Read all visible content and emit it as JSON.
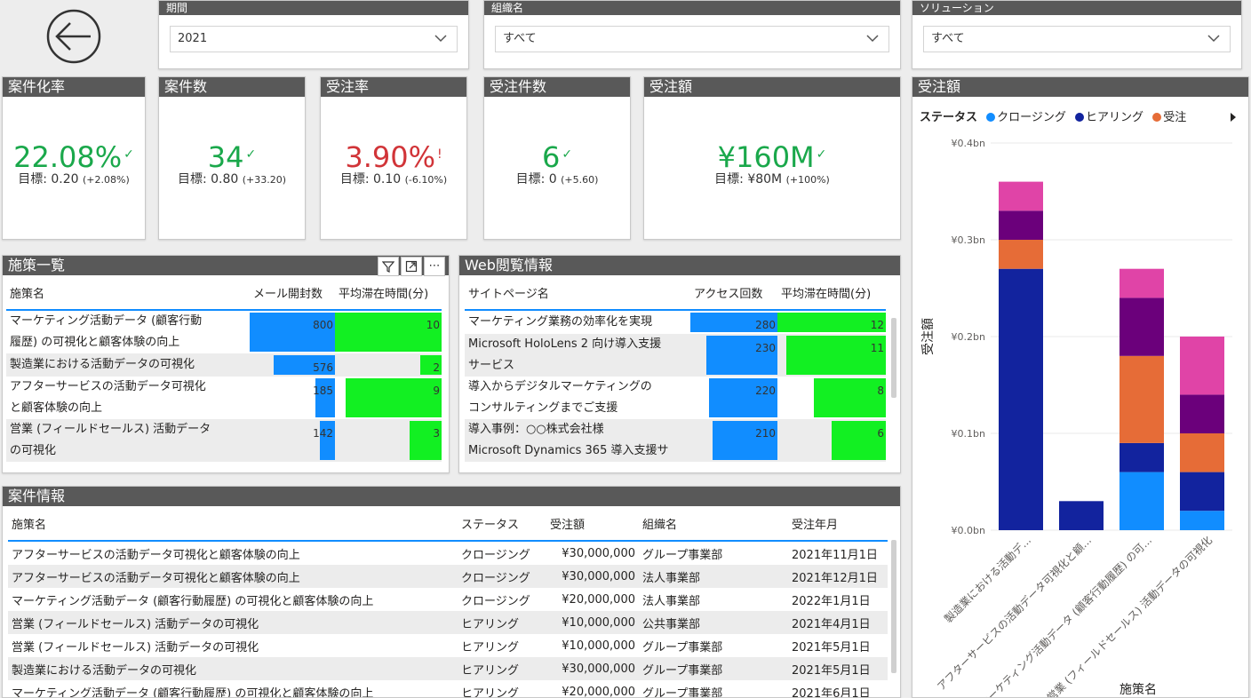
{
  "slicers": {
    "period": {
      "label": "期間",
      "value": "2021"
    },
    "org": {
      "label": "組織名",
      "value": "すべて"
    },
    "solution": {
      "label": "ソリューション",
      "value": "すべて"
    }
  },
  "kpis": [
    {
      "title": "案件化率",
      "value": "22.08%",
      "mark": "✓",
      "status": "good",
      "target_label": "目標: 0.20",
      "target_diff": "(+2.08%)"
    },
    {
      "title": "案件数",
      "value": "34",
      "mark": "✓",
      "status": "good",
      "target_label": "目標: 0.80",
      "target_diff": "(+33.20)"
    },
    {
      "title": "受注率",
      "value": "3.90%",
      "mark": "!",
      "status": "bad",
      "target_label": "目標: 0.10",
      "target_diff": "(-6.10%)"
    },
    {
      "title": "受注件数",
      "value": "6",
      "mark": "✓",
      "status": "good",
      "target_label": "目標: 0",
      "target_diff": "(+5.60)"
    },
    {
      "title": "受注額",
      "value": "¥160M",
      "mark": "✓",
      "status": "good",
      "target_label": "目標: ¥80M",
      "target_diff": "(+100%)"
    }
  ],
  "measures": {
    "title": "施策一覧",
    "columns": [
      "施策名",
      "メール開封数",
      "平均滞在時間(分)"
    ],
    "rows": [
      {
        "name": [
          "マーケティング活動データ (顧客行動",
          "履歴) の可視化と顧客体験の向上"
        ],
        "opens": 800,
        "stay": 10
      },
      {
        "name": [
          "製造業における活動データの可視化"
        ],
        "opens": 576,
        "stay": 2
      },
      {
        "name": [
          "アフターサービスの活動データ可視化",
          "と顧客体験の向上"
        ],
        "opens": 185,
        "stay": 9
      },
      {
        "name": [
          "営業 (フィールドセールス) 活動データ",
          "の可視化"
        ],
        "opens": 142,
        "stay": 3
      }
    ],
    "opens_max": 800,
    "stay_max": 10
  },
  "web": {
    "title": "Web閲覧情報",
    "columns": [
      "サイトページ名",
      "アクセス回数",
      "平均滞在時間(分)"
    ],
    "rows": [
      {
        "name": [
          "マーケティング業務の効率化を実現"
        ],
        "access": 280,
        "stay": 12
      },
      {
        "name": [
          "Microsoft HoloLens 2 向け導入支援",
          "サービス"
        ],
        "access": 230,
        "stay": 11
      },
      {
        "name": [
          "導入からデジタルマーケティングの",
          "コンサルティングまでご支援"
        ],
        "access": 220,
        "stay": 8
      },
      {
        "name": [
          "導入事例：○○株式会社様",
          "Microsoft Dynamics 365 導入支援サ"
        ],
        "access": 210,
        "stay": 6
      }
    ],
    "access_max": 280,
    "stay_max": 12
  },
  "deals": {
    "title": "案件情報",
    "columns": [
      "施策名",
      "ステータス",
      "受注額",
      "組織名",
      "受注年月"
    ],
    "rows": [
      [
        "アフターサービスの活動データ可視化と顧客体験の向上",
        "クロージング",
        "¥30,000,000",
        "グループ事業部",
        "2021年11月1日"
      ],
      [
        "アフターサービスの活動データ可視化と顧客体験の向上",
        "クロージング",
        "¥30,000,000",
        "法人事業部",
        "2021年12月1日"
      ],
      [
        "マーケティング活動データ (顧客行動履歴) の可視化と顧客体験の向上",
        "クロージング",
        "¥20,000,000",
        "法人事業部",
        "2022年1月1日"
      ],
      [
        "営業 (フィールドセールス) 活動データの可視化",
        "ヒアリング",
        "¥10,000,000",
        "公共事業部",
        "2021年4月1日"
      ],
      [
        "営業 (フィールドセールス) 活動データの可視化",
        "ヒアリング",
        "¥10,000,000",
        "グループ事業部",
        "2021年5月1日"
      ],
      [
        "製造業における活動データの可視化",
        "ヒアリング",
        "¥30,000,000",
        "グループ事業部",
        "2021年5月1日"
      ],
      [
        "マーケティング活動データ (顧客行動履歴) の可視化と顧客体験の向上",
        "ヒアリング",
        "¥20,000,000",
        "グループ事業部",
        "2021年6月1日"
      ]
    ]
  },
  "chart_data": {
    "type": "bar",
    "stacked": true,
    "title": "受注額",
    "legend_title": "ステータス",
    "legend_position": "top-left",
    "xlabel": "施策名",
    "ylabel": "受注額",
    "yticks": [
      "¥0.0bn",
      "¥0.1bn",
      "¥0.2bn",
      "¥0.3bn",
      "¥0.4bn"
    ],
    "ylim": [
      0,
      0.4
    ],
    "categories": [
      "製造業における活動デ...",
      "アフターサービスの活動データ可視化と顧...",
      "マーケティング活動データ (顧客行動履歴) の可...",
      "営業 (フィールドセールス) 活動データの可視化"
    ],
    "series": [
      {
        "name": "クロージング",
        "color": "#118dff",
        "values": [
          0,
          0,
          0.06,
          0.02
        ]
      },
      {
        "name": "ヒアリング",
        "color": "#12239e",
        "values": [
          0.27,
          0.03,
          0.03,
          0.04
        ]
      },
      {
        "name": "受注",
        "color": "#e66c37",
        "values": [
          0.03,
          0,
          0.09,
          0.04
        ]
      },
      {
        "name": "",
        "color": "#6b007b",
        "values": [
          0.03,
          0,
          0.06,
          0.04
        ]
      },
      {
        "name": "",
        "color": "#e044a7",
        "values": [
          0.03,
          0,
          0.03,
          0.06
        ]
      }
    ]
  },
  "colors": {
    "good": "#1aa84b",
    "bad": "#d13438",
    "header": "#595959"
  }
}
